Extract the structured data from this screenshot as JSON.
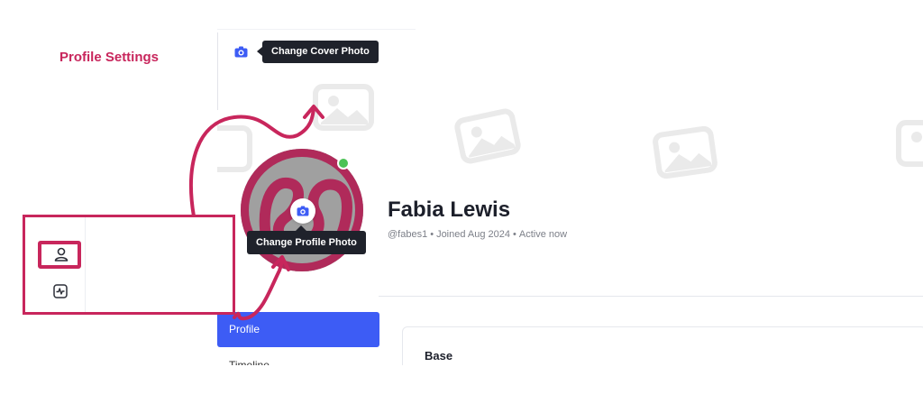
{
  "cover": {
    "tooltip": "Change Cover Photo",
    "camera_icon": "camera-icon",
    "placeholder_icon": "image-placeholder-icon"
  },
  "profile": {
    "name": "Fabia Lewis",
    "handle": "@fabes1",
    "joined": "Joined Aug 2024",
    "status": "Active now",
    "status_color": "#4cc255",
    "avatar_tooltip": "Change Profile Photo"
  },
  "menu": {
    "active_item": "Profile",
    "next_item": "Timeline",
    "accent": "#3d5cf5"
  },
  "card": {
    "title": "Base"
  },
  "annotation": {
    "label": "Profile Settings",
    "color": "#c8265c",
    "icons": [
      "person-icon",
      "activity-icon"
    ]
  }
}
